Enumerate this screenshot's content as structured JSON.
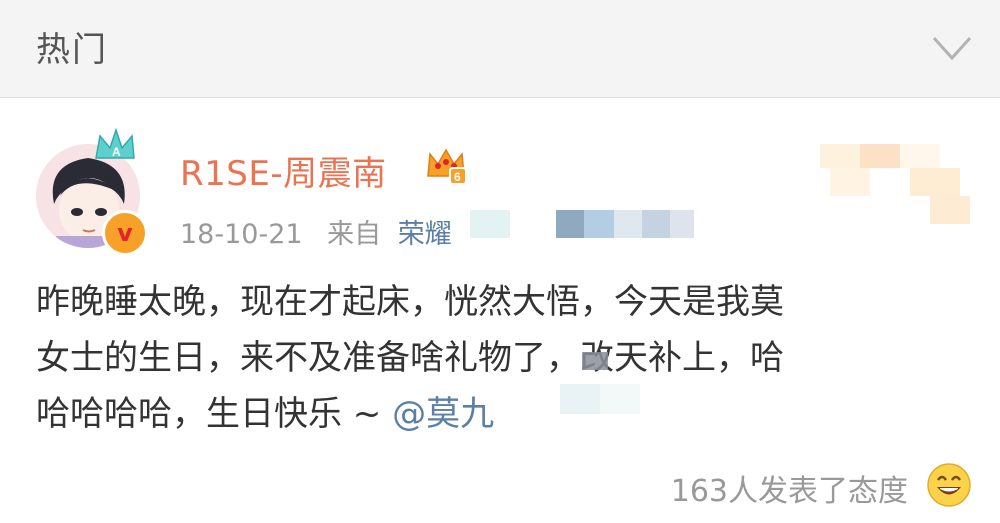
{
  "topbar": {
    "title": "热门"
  },
  "post": {
    "username": "R1SE-周震南",
    "date": "18-10-21",
    "from_label": "来自",
    "source": "荣耀",
    "body_line1": "昨晚睡太晚，现在才起床，恍然大悟，今天是我莫",
    "body_line2": "女士的生日，来不及准备啥礼物了，改天补上，哈",
    "body_line3_prefix": "哈哈哈哈，生日快乐 ~ ",
    "mention": "@莫九",
    "reactions": "163人发表了态度"
  },
  "colors": {
    "username": "#eb7350",
    "link": "#5b7fa6",
    "badge": "#f7a128"
  },
  "icons": [
    "chevron-down-icon",
    "crown-icon",
    "vip-crown-icon",
    "verified-v-icon",
    "smile-emoji-icon"
  ]
}
